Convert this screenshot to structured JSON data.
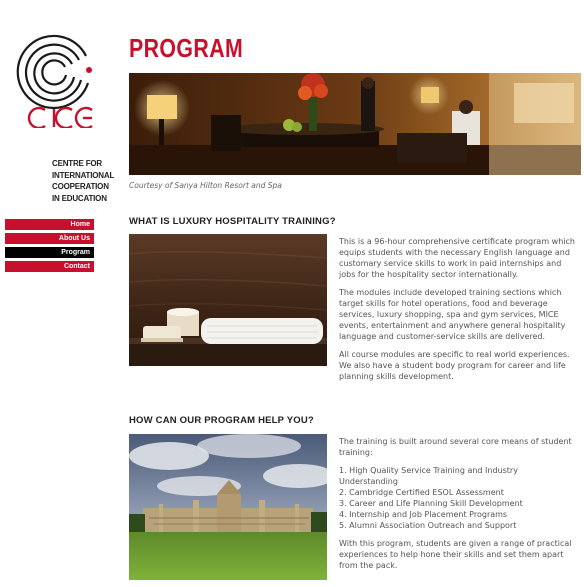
{
  "logo": {
    "wordmark": "CICE",
    "subtitle_lines": [
      "CENTRE FOR",
      "INTERNATIONAL",
      "COOPERATION",
      "IN EDUCATION"
    ]
  },
  "nav": {
    "items": [
      {
        "label": "Home",
        "active": false
      },
      {
        "label": "About Us",
        "active": false
      },
      {
        "label": "Program",
        "active": true
      },
      {
        "label": "Contact",
        "active": false
      }
    ]
  },
  "page": {
    "title": "PROGRAM",
    "hero_caption": "Courtesy of Sanya Hilton Resort and Spa"
  },
  "section1": {
    "title": "WHAT IS LUXURY HOSPITALITY TRAINING?",
    "paragraphs": [
      "This is a 96-hour comprehensive certificate program which equips students with the necessary English language and customary service skills to work in paid internships and jobs for the hospitality sector internationally.",
      "The modules include developed training sections which target skills for hotel operations, food and beverage services, luxury shopping, spa and gym services, MICE events, entertainment and anywhere general hospitality language and customer-service skills are delivered.",
      "All course modules are specific to real world experiences. We also have a student body program for career and life planning skills development."
    ]
  },
  "section2": {
    "title": "HOW CAN OUR PROGRAM HELP YOU?",
    "intro": "The training is built around several core means of student training:",
    "list": [
      "1. High Quality Service Training and Industry Understanding",
      "2. Cambridge Certified ESOL Assessment",
      "3. Career and Life Planning Skill Development",
      "4. Internship and Job Placement Programs",
      "5. Alumni Association Outreach and Support"
    ],
    "outro": "With this program, students are given a range of practical experiences to help hone their skills and set them apart from the pack."
  },
  "colors": {
    "accent": "#c8102e",
    "nav_active": "#000000",
    "body_text": "#555555"
  }
}
